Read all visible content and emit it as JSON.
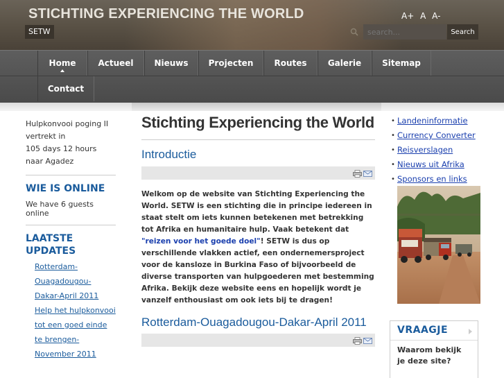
{
  "header": {
    "site_title": "STICHTING EXPERIENCING THE WORLD",
    "site_abbr": "SETW",
    "font_sizes": [
      "A+",
      "A",
      "A-"
    ],
    "search_placeholder": "search...",
    "search_button": "Search"
  },
  "nav": {
    "items": [
      "Home",
      "Actueel",
      "Nieuws",
      "Projecten",
      "Routes",
      "Galerie",
      "Sitemap",
      "Contact"
    ],
    "active": "Home"
  },
  "left": {
    "countdown_line1": "Hulpkonvooi poging II",
    "countdown_line2": "vertrekt in",
    "countdown_line3": "105 days 12 hours",
    "countdown_line4": "naar Agadez",
    "online_heading": "WIE IS ONLINE",
    "online_text": "We have 6 guests online",
    "updates_heading": "LAATSTE UPDATES",
    "updates": [
      "Rotterdam-Ouagadougou-Dakar-April 2011",
      "Help het hulpkonvooi tot een goed einde te brengen-November 2011"
    ]
  },
  "main": {
    "page_title": "Stichting Experiencing the World",
    "article1_title": "Introductie",
    "article1_text_before": "Welkom op de website van Stichting Experiencing the World. SETW is een stichting die in principe iedereen in staat stelt om iets kunnen betekenen met betrekking tot Afrika en humanitaire hulp. Vaak betekent dat ",
    "article1_link": "\"reizen voor het goede doel\"",
    "article1_text_after": "! SETW is dus op verschillende vlakken actief, een ondernemersproject voor de kansloze in Burkina Faso of bijvoorbeeld de diverse transporten van hulpgoederen met bestemming Afrika. Bekijk deze website eens en hopelijk wordt je vanzelf enthousiast om ook iets bij te dragen!",
    "article2_title": "Rotterdam-Ouagadougou-Dakar-April 2011"
  },
  "right": {
    "links": [
      "Landeninformatie",
      "Currency Converter",
      "Reisverslagen",
      "Nieuws uit Afrika",
      "Sponsors en links"
    ],
    "vraagje_heading": "VRAAGJE",
    "vraagje_question": "Waarom bekijk je deze site?"
  },
  "colors": {
    "link_blue": "#1a5b9c",
    "nav_bg": "#4e4e4e",
    "header_bg": "#5a5246"
  }
}
